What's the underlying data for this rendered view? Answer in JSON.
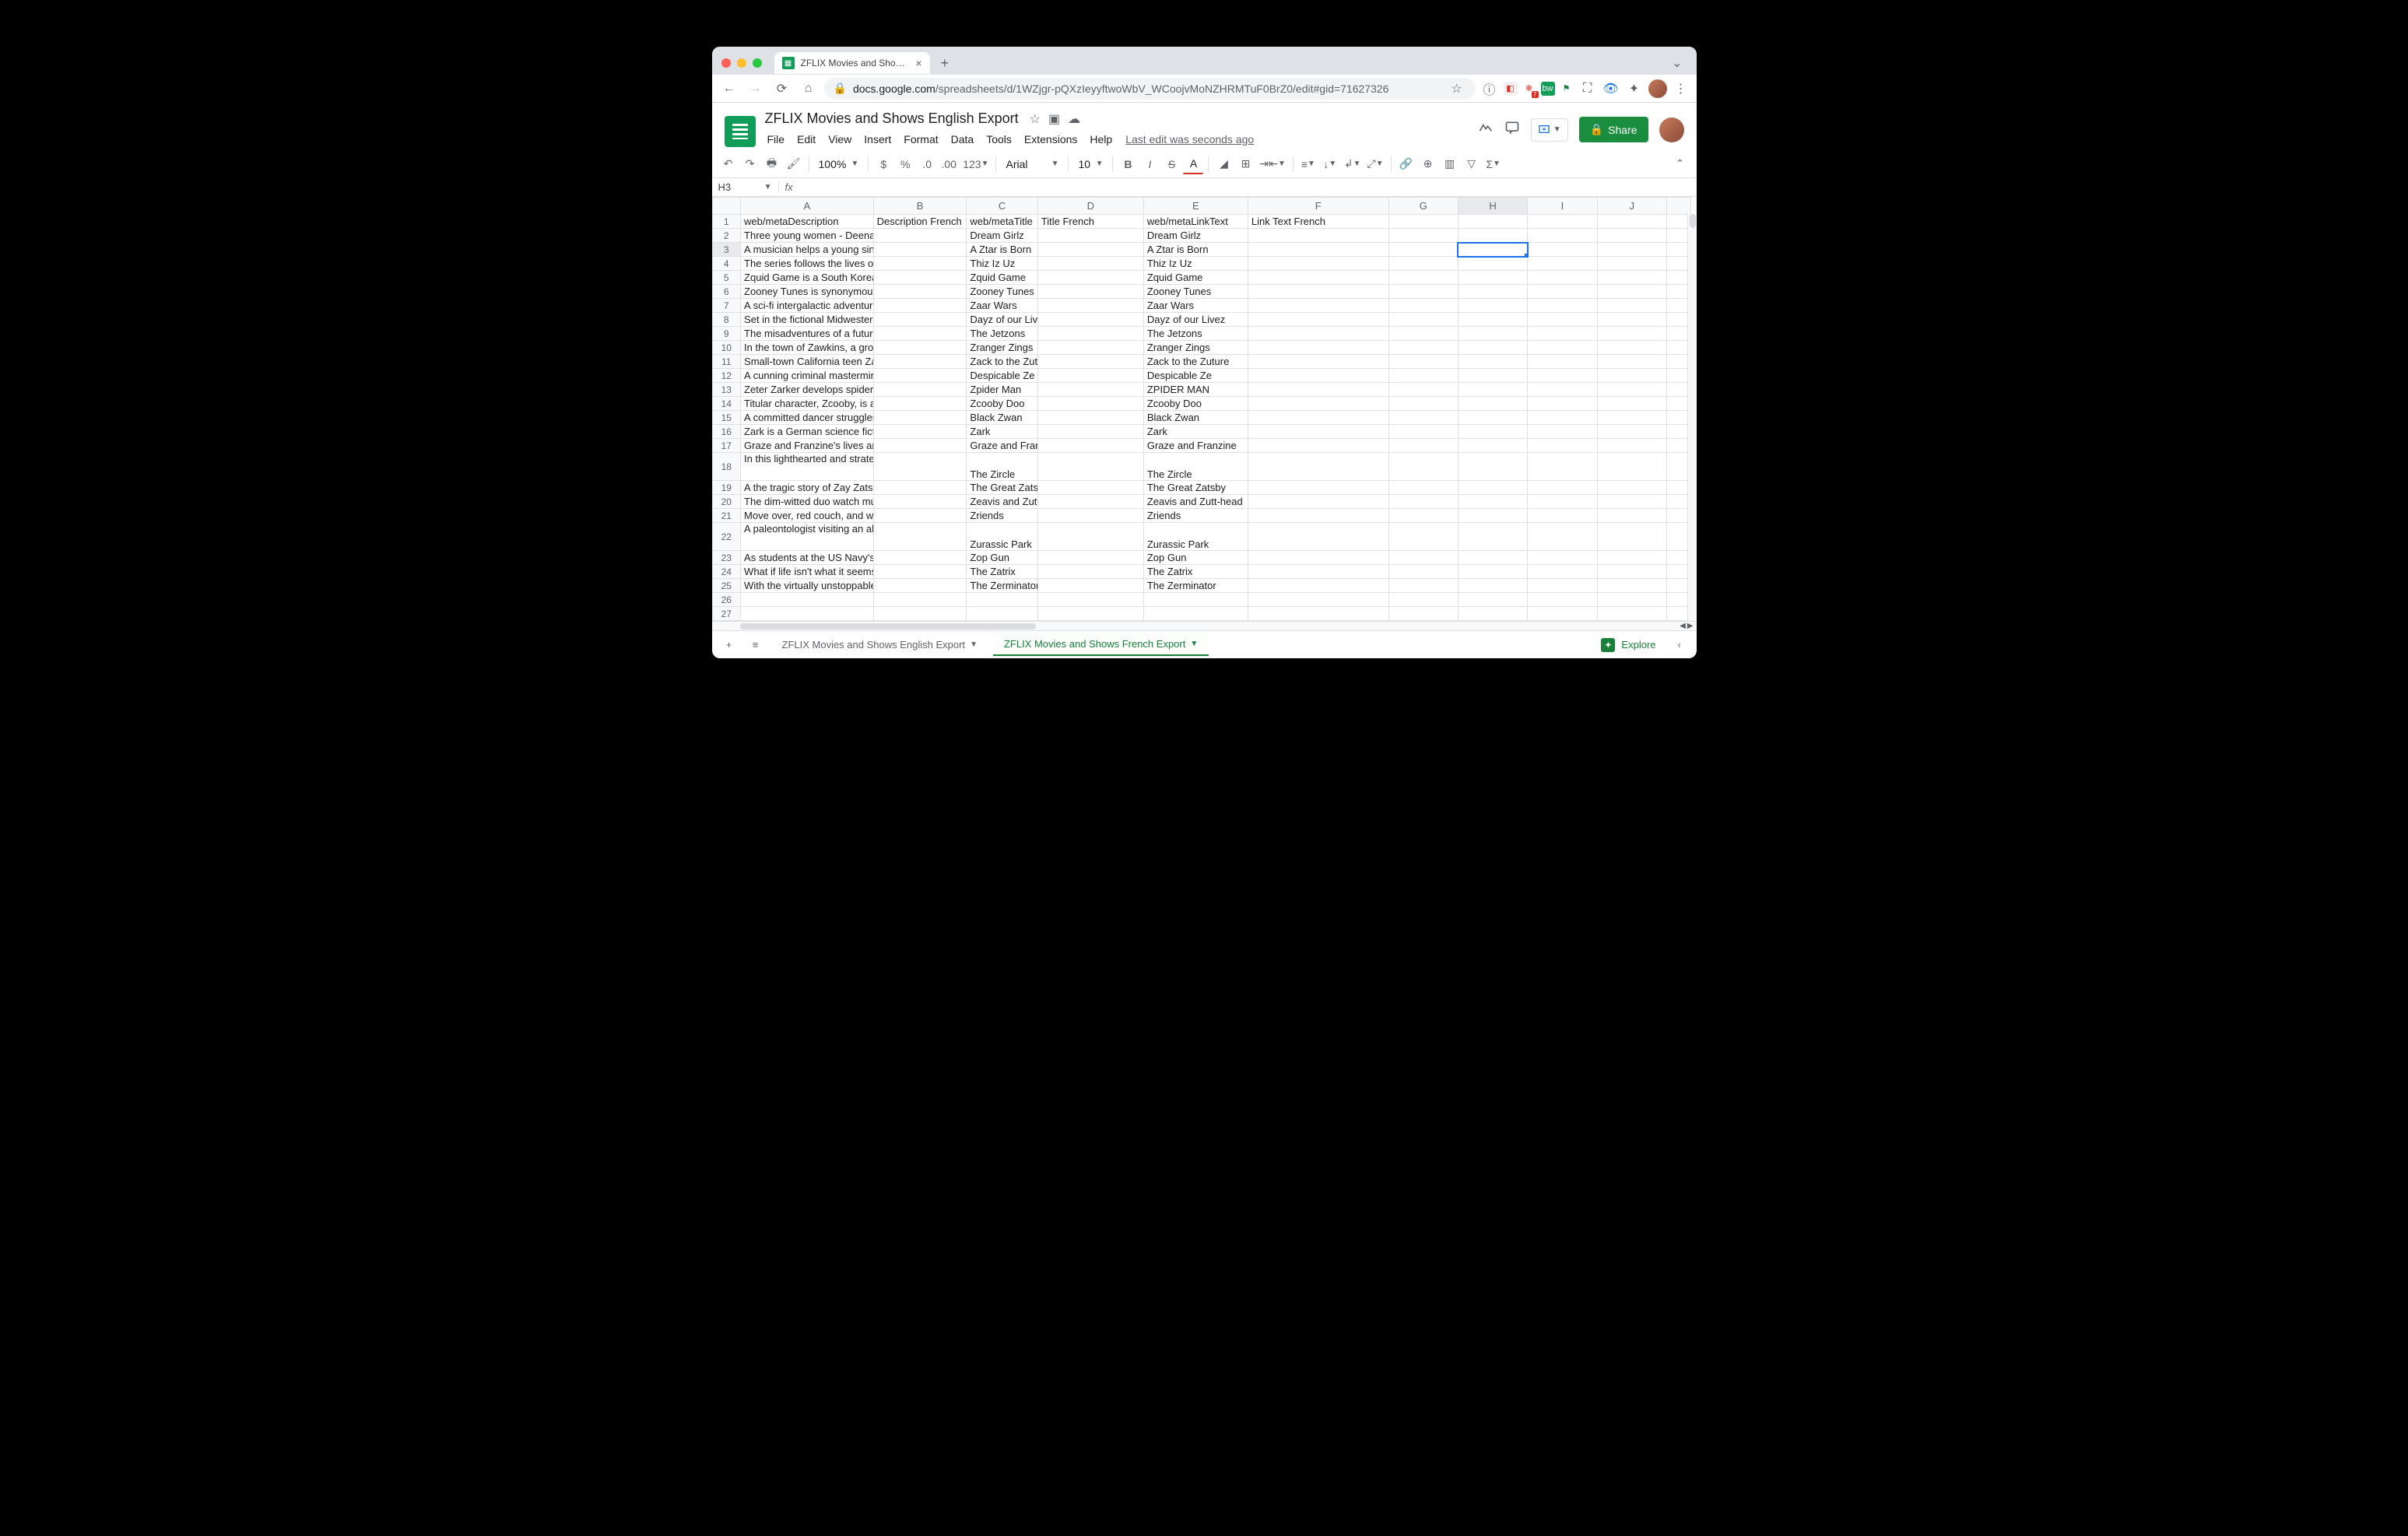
{
  "browser": {
    "tab_title": "ZFLIX Movies and Shows Engli",
    "url_domain": "docs.google.com",
    "url_path": "/spreadsheets/d/1WZjgr-pQXzIeyyftwoWbV_WCoojvMoNZHRMTuF0BrZ0/edit#gid=71627326"
  },
  "doc": {
    "title": "ZFLIX Movies and Shows English Export",
    "last_edit": "Last edit was seconds ago",
    "share": "Share"
  },
  "menus": [
    "File",
    "Edit",
    "View",
    "Insert",
    "Format",
    "Data",
    "Tools",
    "Extensions",
    "Help"
  ],
  "toolbar": {
    "zoom": "100%",
    "font": "Arial",
    "size": "10"
  },
  "namebox": "H3",
  "formula": "",
  "columns": [
    "A",
    "B",
    "C",
    "D",
    "E",
    "F",
    "G",
    "H",
    "I",
    "J",
    ""
  ],
  "headers": {
    "A": "web/metaDescription",
    "B": "Description French",
    "C": "web/metaTitle",
    "D": "Title French",
    "E": "web/metaLinkText",
    "F": "Link Text French"
  },
  "rows": [
    {
      "n": 2,
      "a": "Three young women - Deena Jo",
      "c": "Dream Girlz",
      "e": "Dream Girlz"
    },
    {
      "n": 3,
      "a": "A musician helps a young singe",
      "c": "A Ztar is Born",
      "e": "A Ztar is Born"
    },
    {
      "n": 4,
      "a": "The series follows the lives of s",
      "c": "Thiz Iz Uz",
      "e": "Thiz Iz Uz"
    },
    {
      "n": 5,
      "a": "Zquid Game is a South Korean",
      "c": "Zquid Game",
      "e": "Zquid Game"
    },
    {
      "n": 6,
      "a": "Zooney Tunes is synonymous w",
      "c": "Zooney Tunes",
      "e": "Zooney Tunes"
    },
    {
      "n": 7,
      "a": "A sci-fi intergalactic adventure f",
      "c": "Zaar Wars",
      "e": "Zaar Wars"
    },
    {
      "n": 8,
      "a": "Set in the fictional Midwestern t",
      "c": "Dayz of our Live",
      "e": "Dayz of our Livez"
    },
    {
      "n": 9,
      "a": "The misadventures of a futuristi",
      "c": "The Jetzons",
      "e": "The Jetzons"
    },
    {
      "n": 10,
      "a": "In the town of Zawkins, a group",
      "c": "Zranger Zings",
      "e": "Zranger Zings"
    },
    {
      "n": 11,
      "a": "Small-town California teen Zarty",
      "c": "Zack to the Zutu",
      "e": "Zack to the Zuture"
    },
    {
      "n": 12,
      "a": "A cunning criminal mastermind",
      "c": "Despicable Ze",
      "e": "Despicable Ze"
    },
    {
      "n": 13,
      "a": "Zeter Zarker develops spider-lik",
      "c": "Zpider Man",
      "e": "ZPIDER MAN"
    },
    {
      "n": 14,
      "a": "Titular character, Zcooby, is acc",
      "c": "Zcooby Doo",
      "e": "Zcooby Doo"
    },
    {
      "n": 15,
      "a": "A committed dancer struggles t",
      "c": "Black Zwan",
      "e": "Black Zwan"
    },
    {
      "n": 16,
      "a": "Zark is a German science fictio",
      "c": "Zark",
      "e": "Zark"
    },
    {
      "n": 17,
      "a": "Graze and Franzine's lives are",
      "c": "Graze and Franz",
      "e": "Graze and Franzine"
    },
    {
      "n": 18,
      "a": "In this lighthearted and strategic",
      "c": "The Zircle",
      "e": "The Zircle",
      "tall": true
    },
    {
      "n": 19,
      "a": "A the tragic story of Zay Zatsby",
      "c": "The Great Zatsb",
      "e": "The Great Zatsby"
    },
    {
      "n": 20,
      "a": "The dim-witted duo watch musi",
      "c": "Zeavis and Zutt-",
      "e": "Zeavis and Zutt-head"
    },
    {
      "n": 21,
      "a": "Move over, red couch, and welc",
      "c": "Zriends",
      "e": "Zriends"
    },
    {
      "n": 22,
      "a": "A paleontologist visiting an alm",
      "c": "Zurassic Park",
      "e": "Zurassic Park",
      "tall": true
    },
    {
      "n": 23,
      "a": "As students at the US Navy's el",
      "c": "Zop Gun",
      "e": "Zop Gun"
    },
    {
      "n": 24,
      "a": "What if life isn't what it seems...",
      "c": "The Zatrix",
      "e": "The Zatrix"
    },
    {
      "n": 25,
      "a": "With the virtually unstoppable Z",
      "c": "The Zerminator",
      "e": "The Zerminator"
    },
    {
      "n": 26,
      "a": "",
      "c": "",
      "e": ""
    },
    {
      "n": 27,
      "a": "",
      "c": "",
      "e": ""
    }
  ],
  "selected": {
    "col": "H",
    "row": 3
  },
  "sheets": {
    "tab1": "ZFLIX Movies and Shows English Export",
    "tab2": "ZFLIX Movies and Shows French Export",
    "explore": "Explore"
  }
}
